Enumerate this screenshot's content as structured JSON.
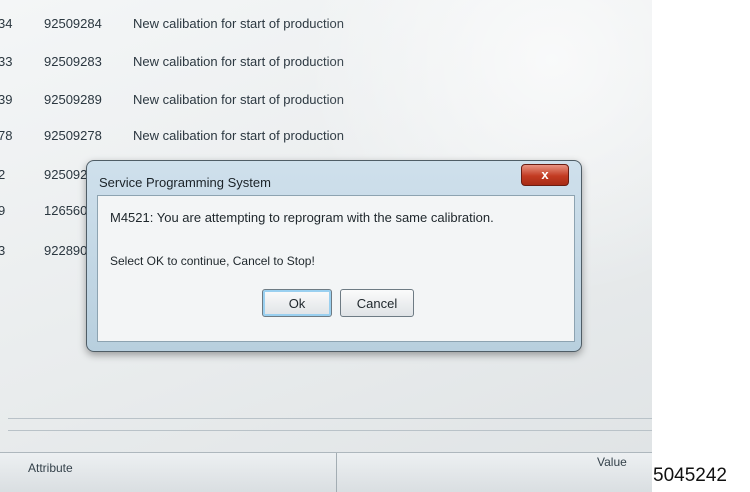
{
  "background_rows": [
    {
      "id1": "34",
      "id2": "92509284",
      "desc": "New calibation for start of production"
    },
    {
      "id1": "33",
      "id2": "92509283",
      "desc": "New calibation for start of production"
    },
    {
      "id1": "39",
      "id2": "92509289",
      "desc": "New calibation for start of production"
    },
    {
      "id1": "78",
      "id2": "92509278",
      "desc": "New calibation for start of production"
    },
    {
      "id1": "2",
      "id2": "925092",
      "desc": ""
    },
    {
      "id1": "9",
      "id2": "126560",
      "desc": ""
    },
    {
      "id1": "3",
      "id2": "922890",
      "desc": ""
    }
  ],
  "dialog": {
    "title": "Service Programming System",
    "close_label": "x",
    "message": "M4521: You are attempting to reprogram with the same calibration.",
    "instruction": "Select OK to continue, Cancel to Stop!",
    "ok_label": "Ok",
    "cancel_label": "Cancel"
  },
  "table_header": {
    "attribute": "Attribute",
    "value": "Value"
  },
  "side_number": "5045242",
  "colors": {
    "close_button": "#c23b22",
    "dialog_frame": "#b8cfde",
    "focus_ring": "#9ad0f0"
  }
}
